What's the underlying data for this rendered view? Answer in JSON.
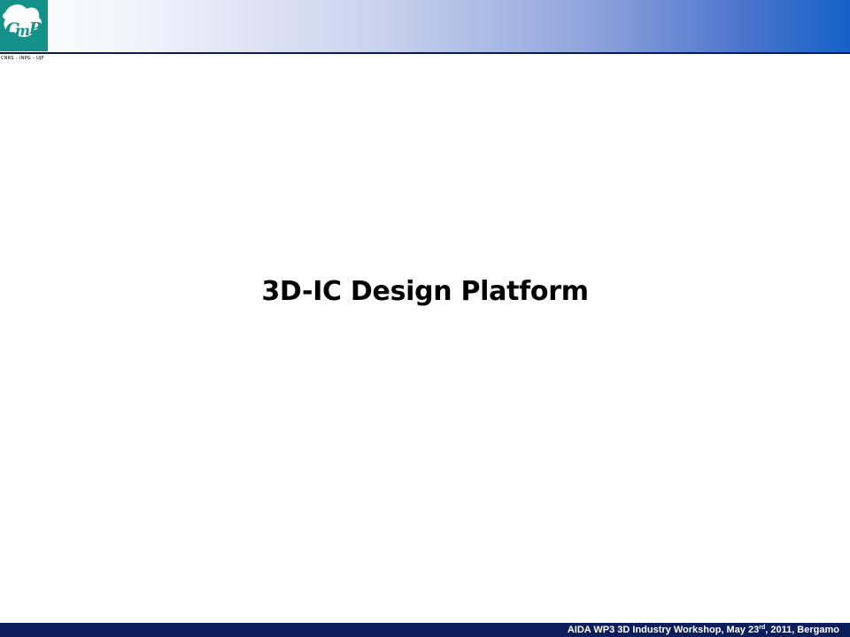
{
  "header": {
    "logo_name": "CMP",
    "logo_caption": "CNRS – INPG – UJF",
    "gradient_colors": [
      "#ffffff",
      "#c9d2ee",
      "#8ea3dc",
      "#1561c8"
    ],
    "logo_color": "#14928a"
  },
  "slide": {
    "title": "3D-IC Design Platform"
  },
  "footer": {
    "text_before_sup": "AIDA WP3 3D Industry Workshop, May 23",
    "sup": "rd",
    "text_after_sup": ", 2011, Bergamo",
    "background": "#0c1e5c"
  }
}
